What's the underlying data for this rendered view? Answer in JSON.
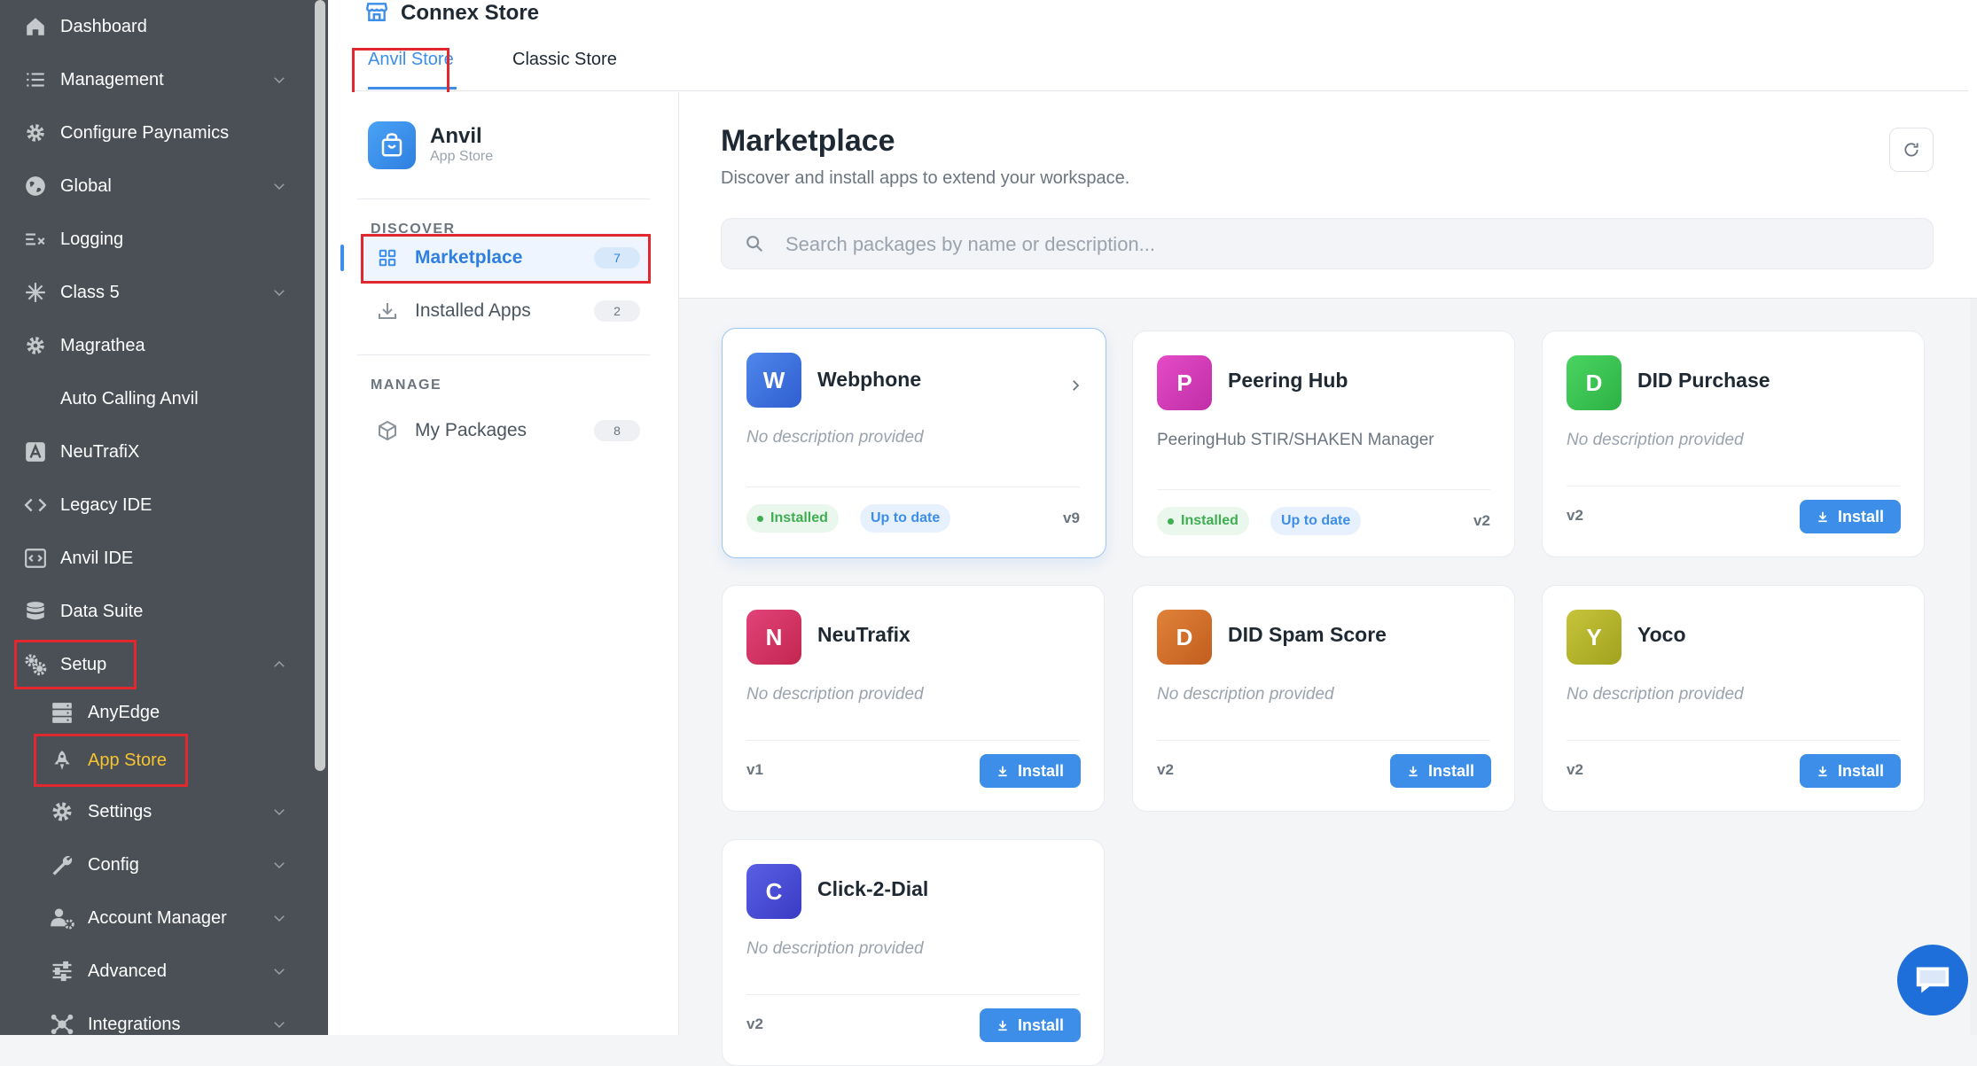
{
  "left_nav": {
    "items": [
      {
        "label": "Dashboard",
        "icon": "home-icon"
      },
      {
        "label": "Management",
        "icon": "list-icon"
      },
      {
        "label": "Configure Paynamics",
        "icon": "gear-icon"
      },
      {
        "label": "Global",
        "icon": "globe-icon"
      },
      {
        "label": "Logging",
        "icon": "logging-icon"
      },
      {
        "label": "Class 5",
        "icon": "asterisk-icon"
      },
      {
        "label": "Magrathea",
        "icon": "gear-icon"
      },
      {
        "label": "Auto Calling Anvil",
        "icon": ""
      },
      {
        "label": "NeuTrafiX",
        "icon": "neutrafix-icon"
      },
      {
        "label": "Legacy IDE",
        "icon": "code-icon"
      },
      {
        "label": "Anvil IDE",
        "icon": "code-box-icon"
      },
      {
        "label": "Data Suite",
        "icon": "database-icon"
      },
      {
        "label": "Setup",
        "icon": "gears-icon"
      }
    ],
    "setup_children": [
      {
        "label": "AnyEdge",
        "icon": "server-icon"
      },
      {
        "label": "App Store",
        "icon": "rocket-icon"
      },
      {
        "label": "Settings",
        "icon": "gear-icon"
      },
      {
        "label": "Config",
        "icon": "wrench-icon"
      },
      {
        "label": "Account Manager",
        "icon": "users-gear-icon"
      },
      {
        "label": "Advanced",
        "icon": "sliders-icon"
      },
      {
        "label": "Integrations",
        "icon": "network-icon"
      }
    ]
  },
  "header": {
    "title": "Connex Store",
    "tabs": [
      {
        "label": "Anvil Store",
        "active": true
      },
      {
        "label": "Classic Store",
        "active": false
      }
    ]
  },
  "brand": {
    "name": "Anvil",
    "subtitle": "App Store"
  },
  "sidebar": {
    "discover_label": "DISCOVER",
    "manage_label": "MANAGE",
    "items": [
      {
        "label": "Marketplace",
        "count": "7",
        "active": true
      },
      {
        "label": "Installed Apps",
        "count": "2",
        "active": false
      },
      {
        "label": "My Packages",
        "count": "8",
        "active": false
      }
    ]
  },
  "marketplace": {
    "title": "Marketplace",
    "subtitle": "Discover and install apps to extend your workspace.",
    "search_placeholder": "Search packages by name or description..."
  },
  "packages": [
    {
      "letter": "W",
      "name": "Webphone",
      "description": "No description provided",
      "version": "v9",
      "installed": true,
      "installed_label": "Installed",
      "status_label": "Up to date",
      "color": "#3f6fd8"
    },
    {
      "letter": "P",
      "name": "Peering Hub",
      "description": "PeeringHub STIR/SHAKEN Manager",
      "version": "v2",
      "installed": true,
      "installed_label": "Installed",
      "status_label": "Up to date",
      "color": "#d63ab8"
    },
    {
      "letter": "D",
      "name": "DID Purchase",
      "description": "No description provided",
      "version": "v2",
      "installed": false,
      "install_label": "Install",
      "color": "#37c24d"
    },
    {
      "letter": "N",
      "name": "NeuTrafix",
      "description": "No description provided",
      "version": "v1",
      "installed": false,
      "install_label": "Install",
      "color": "#d83265"
    },
    {
      "letter": "D",
      "name": "DID Spam Score",
      "description": "No description provided",
      "version": "v2",
      "installed": false,
      "install_label": "Install",
      "color": "#d7702a"
    },
    {
      "letter": "Y",
      "name": "Yoco",
      "description": "No description provided",
      "version": "v2",
      "installed": false,
      "install_label": "Install",
      "color": "#b7b82a"
    },
    {
      "letter": "C",
      "name": "Click-2-Dial",
      "description": "No description provided",
      "version": "v2",
      "installed": false,
      "install_label": "Install",
      "color": "#4a4fd6"
    }
  ],
  "colors": {
    "accent": "#3c8ee8",
    "nav_bg": "#4a5055",
    "highlight": "#e0282e",
    "active_sub": "#f7c431",
    "installed_green": "#3fae52"
  }
}
